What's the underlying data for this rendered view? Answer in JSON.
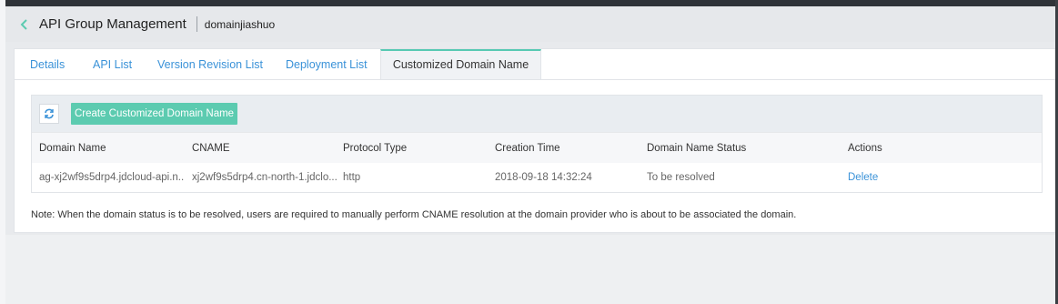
{
  "header": {
    "title": "API Group Management",
    "subtitle": "domainjiashuo",
    "back_icon": "chevron-left-icon"
  },
  "tabs": [
    {
      "label": "Details",
      "active": false
    },
    {
      "label": "API List",
      "active": false
    },
    {
      "label": "Version Revision List",
      "active": false
    },
    {
      "label": "Deployment List",
      "active": false
    },
    {
      "label": "Customized Domain Name",
      "active": true
    }
  ],
  "toolbar": {
    "refresh_icon": "refresh-icon",
    "create_label": "Create Customized Domain Name"
  },
  "table": {
    "columns": [
      "Domain Name",
      "CNAME",
      "Protocol Type",
      "Creation Time",
      "Domain Name Status",
      "Actions"
    ],
    "rows": [
      {
        "domain_name": "ag-xj2wf9s5drp4.jdcloud-api.n...",
        "cname": "xj2wf9s5drp4.cn-north-1.jdclo...",
        "protocol": "http",
        "creation_time": "2018-09-18 14:32:24",
        "status": "To be resolved",
        "action": "Delete"
      }
    ]
  },
  "note": "Note: When the domain status is to be resolved, users are required to manually perform CNAME resolution at the domain provider who is about to be associated the domain.",
  "colors": {
    "accent": "#5ccbb0",
    "link": "#3a92d8"
  }
}
